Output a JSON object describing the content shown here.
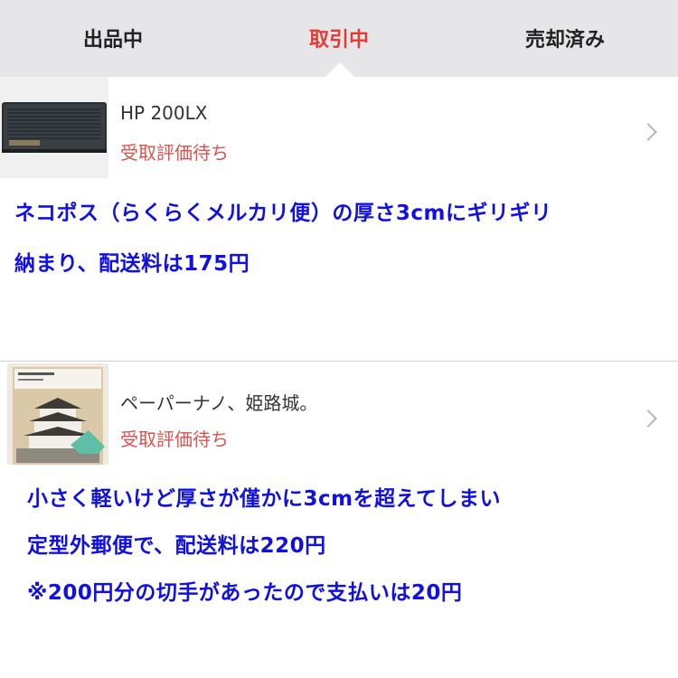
{
  "tabs": [
    {
      "label": "出品中"
    },
    {
      "label": "取引中"
    },
    {
      "label": "売却済み"
    }
  ],
  "accent_color": "#e53935",
  "items": [
    {
      "title": "HP 200LX",
      "status": "受取評価待ち",
      "thumbnail_icon": "laptop-photo",
      "notes": [
        "ネコポス（らくらくメルカリ便）の厚さ3cmにギリギリ",
        "納まり、配送料は175円"
      ]
    },
    {
      "title": "ペーパーナノ、姫路城。",
      "status": "受取評価待ち",
      "thumbnail_icon": "castle-model-photo",
      "notes": [
        "小さく軽いけど厚さが僅かに3cmを超えてしまい",
        "定型外郵便で、配送料は220円",
        "※200円分の切手があったので支払いは20円"
      ]
    }
  ],
  "status_color": "#d9534f",
  "note_color": "#1010e0"
}
